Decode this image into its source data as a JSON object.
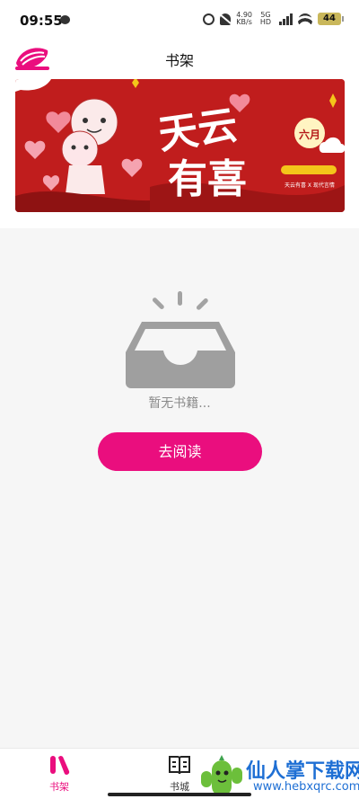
{
  "status_bar": {
    "time": "09:55",
    "net_speed": "4.90",
    "net_unit": "KB/s",
    "network_type": "5G HD",
    "battery": "44"
  },
  "header": {
    "title": "书架"
  },
  "banner": {
    "headline_line1": "天云",
    "headline_line2": "有喜",
    "badge": "六月",
    "caption": "天云有喜 X 现代言情"
  },
  "empty_state": {
    "message": "暂无书籍...",
    "button_label": "去阅读"
  },
  "tab_bar": {
    "items": [
      {
        "label": "书架",
        "icon": "bookshelf-icon",
        "active": true
      },
      {
        "label": "书城",
        "icon": "bookstore-icon",
        "active": false
      }
    ]
  },
  "watermark": {
    "text": "仙人掌下载网",
    "url": "www.hebxqrc.com"
  },
  "colors": {
    "accent": "#ea0e7e",
    "banner_red": "#c01d1d",
    "background": "#f6f6f6"
  }
}
